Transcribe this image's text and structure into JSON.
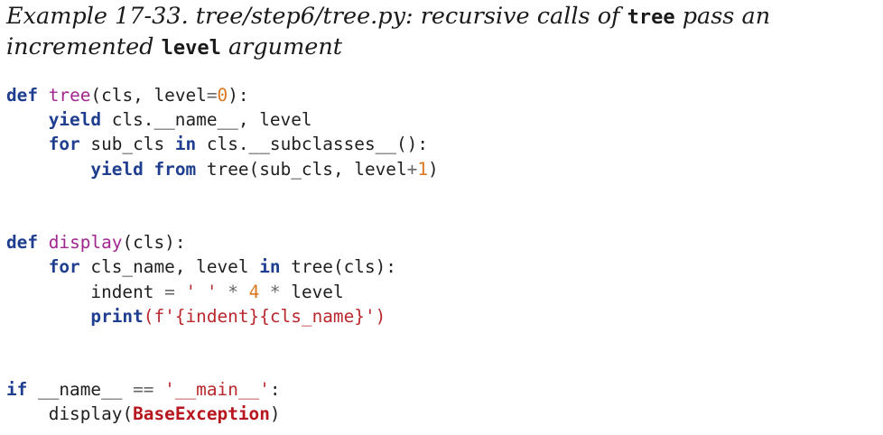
{
  "caption": {
    "prefix": "Example 17-33. tree/step6/tree.py: recursive calls of ",
    "code1": "tree",
    "middle": " pass an incremented ",
    "code2": "level",
    "suffix": " argument"
  },
  "code": {
    "def": "def",
    "tree": "tree",
    "tree_params_1": "(cls, level",
    "eq": "=",
    "zero": "0",
    "tree_params_2": "):",
    "yield": "yield",
    "l2_rest": " cls.__name__, level",
    "for": "for",
    "l3_a": " sub_cls ",
    "in": "in",
    "l3_b": " cls.__subclasses__():",
    "yield2": "yield",
    "from": "from",
    "l4_tree": " tree",
    "l4_rest": "(sub_cls, level",
    "plus": "+",
    "one": "1",
    "close": ")",
    "def2": "def",
    "display": "display",
    "display_params": "(cls):",
    "for2": "for",
    "l6_a": " cls_name, level ",
    "in2": "in",
    "l6_tree": " tree",
    "l6_rest": "(cls):",
    "indent_var": "indent ",
    "eq2": "=",
    "space_str": " ' ' ",
    "mul1": "*",
    "four": " 4 ",
    "mul2": "*",
    "level_var": " level",
    "print": "print",
    "fstring": "(f'{indent}{cls_name}')",
    "if": "if",
    "dunder_name": " __name__ ",
    "eqeq": "==",
    "main_str": " '__main__'",
    "colon": ":",
    "display_call": "display",
    "open_paren": "(",
    "base_exception": "BaseException",
    "close_paren": ")"
  }
}
